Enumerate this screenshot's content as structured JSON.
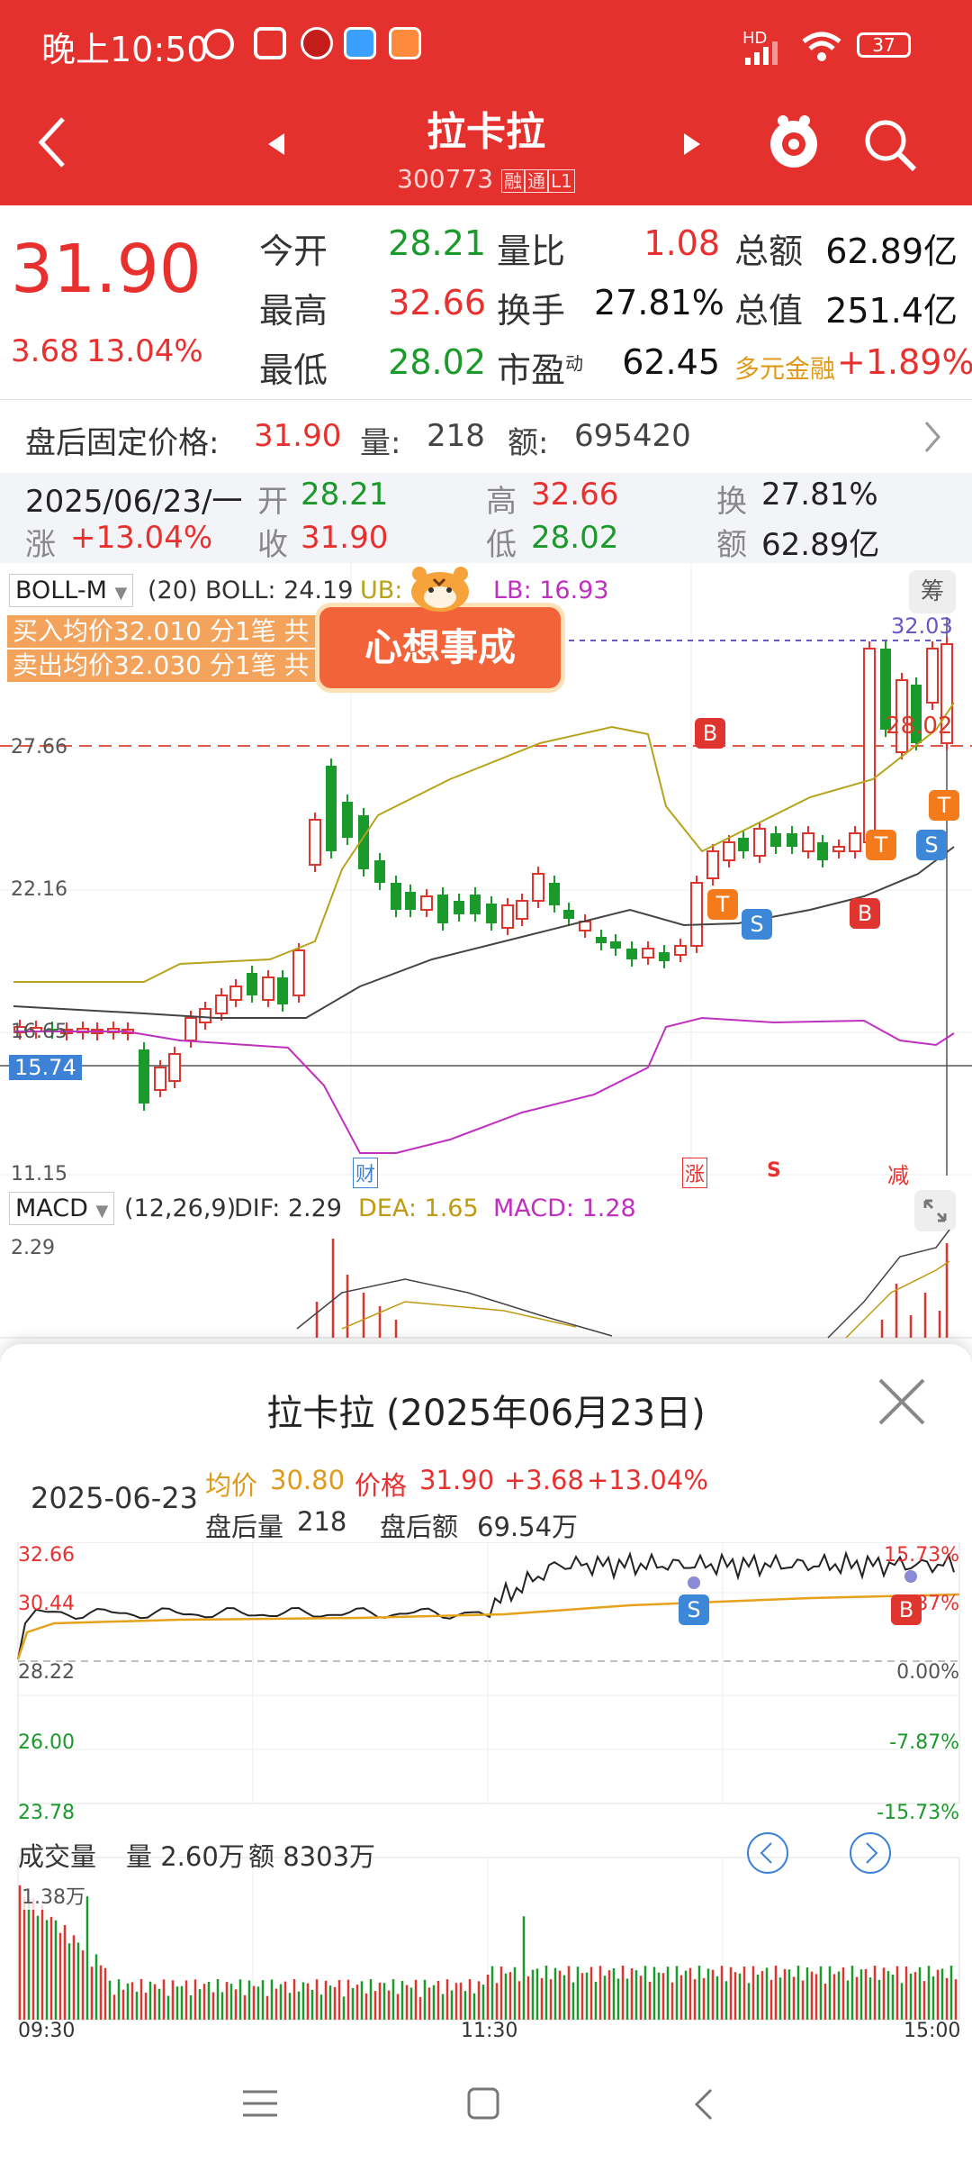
{
  "status_bar": {
    "time": "晚上10:50",
    "battery": "37",
    "network": "HD"
  },
  "header": {
    "title": "拉卡拉",
    "code": "300773",
    "tag1": "融",
    "tag2": "通",
    "tag3": "L1",
    "colors": {
      "bg": "#e5312e"
    }
  },
  "quote": {
    "price": "31.90",
    "change": "3.68",
    "change_pct": "13.04%",
    "rows": [
      {
        "l1": "今开",
        "v1": "28.21",
        "l2": "量比",
        "v2": "1.08",
        "l3": "总额",
        "v3": "62.89亿"
      },
      {
        "l1": "最高",
        "v1": "32.66",
        "l2": "换手",
        "v2": "27.81%",
        "l3": "总值",
        "v3": "251.4亿"
      },
      {
        "l1": "最低",
        "v1": "28.02",
        "l2": "市盈",
        "l2sup": "动",
        "v2": "62.45",
        "l3": "多元金融",
        "v3": "+1.89%"
      }
    ]
  },
  "after_hours": {
    "label": "盘后固定价格:",
    "price": "31.90",
    "vol_label": "量:",
    "vol": "218",
    "amt_label": "额:",
    "amt": "695420"
  },
  "day_info": {
    "date": "2025/06/23/一",
    "open_l": "开",
    "open": "28.21",
    "high_l": "高",
    "high": "32.66",
    "turn_l": "换",
    "turn": "27.81%",
    "chg_l": "涨",
    "chg": "+13.04%",
    "close_l": "收",
    "close": "31.90",
    "low_l": "低",
    "low": "28.02",
    "amt_l": "额",
    "amt": "62.89亿"
  },
  "kline": {
    "indicator": "BOLL-M",
    "boll": "(20) BOLL: 24.19",
    "ub": "UB:",
    "lb": "LB: 16.93",
    "chip_label": "筹",
    "buy_avg": "买入均价32.010 分1笔 共",
    "sell_avg": "卖出均价32.030 分1笔 共",
    "banner": "心想事成",
    "axis": {
      "y1": "27.66",
      "y2": "22.16",
      "y3": "16.65",
      "y4": "11.15",
      "cross": "15.74",
      "hi_line": "32.03",
      "mid_line": "28.02"
    },
    "event_labels": {
      "cai": "财",
      "zhang": "涨",
      "s": "S",
      "jian": "减"
    },
    "signals": [
      "B",
      "T",
      "S",
      "B",
      "T",
      "S",
      "T"
    ],
    "macd_label": "MACD",
    "macd_params": "(12,26,9)",
    "dif": "DIF: 2.29",
    "dea": "DEA: 1.65",
    "macd": "MACD: 1.28",
    "macd_top": "2.29"
  },
  "intraday": {
    "title": "拉卡拉 (2025年06月23日)",
    "date": "2025-06-23",
    "avg_label": "均价",
    "avg": "30.80",
    "price_label": "价格",
    "price": "31.90",
    "chg": "+3.68",
    "pct": "+13.04%",
    "ah_vol_label": "盘后量",
    "ah_vol": "218",
    "ah_amt_label": "盘后额",
    "ah_amt": "69.54万",
    "y_left": [
      "32.66",
      "30.44",
      "28.22",
      "26.00",
      "23.78"
    ],
    "y_right": [
      "15.73%",
      "7.87%",
      "0.00%",
      "-7.87%",
      "-15.73%"
    ],
    "vol_title": "成交量",
    "vol_label": "量 2.60万",
    "amt_label": "额 8303万",
    "vol_max": "1.38万",
    "time_start": "09:30",
    "time_mid": "11:30",
    "time_end": "15:00",
    "signal_s": "S",
    "signal_b": "B"
  }
}
